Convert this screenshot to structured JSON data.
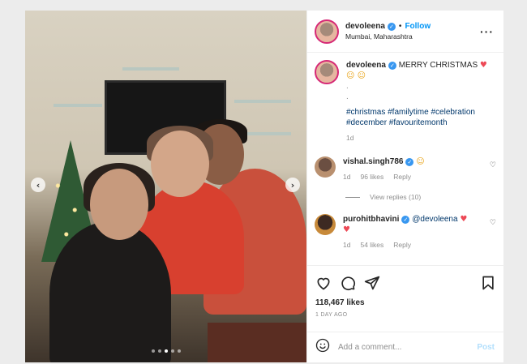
{
  "post": {
    "username": "devoleena",
    "follow_label": "Follow",
    "location": "Mumbai, Maharashtra"
  },
  "caption": {
    "username": "devoleena",
    "text": "MERRY CHRISTMAS",
    "dot1": ".",
    "dot2": ".",
    "hashtags_line1": "#christmas #familytime #celebration",
    "hashtags_line2": "#december #favouritemonth",
    "age": "1d"
  },
  "comments": [
    {
      "username": "vishal.singh786",
      "text": "",
      "age": "1d",
      "likes": "96 likes",
      "reply": "Reply"
    },
    {
      "username": "purohitbhavini",
      "text": "@devoleena",
      "age": "1d",
      "likes": "54 likes",
      "reply": "Reply"
    }
  ],
  "view_replies": "View replies (10)",
  "likes_count": "118,467 likes",
  "date": "1 DAY AGO",
  "add_comment": {
    "placeholder": "Add a comment...",
    "post_label": "Post"
  },
  "carousel": {
    "slides": 5,
    "active_index": 2
  },
  "colors": {
    "accent": "#0095f6",
    "verified": "#3897f0",
    "heart": "#ed4956"
  },
  "icons": [
    "more-options-icon",
    "verified-badge-icon",
    "heart-icon",
    "comment-icon",
    "share-icon",
    "bookmark-icon",
    "emoji-smiley-icon",
    "carousel-prev-icon",
    "carousel-next-icon"
  ]
}
